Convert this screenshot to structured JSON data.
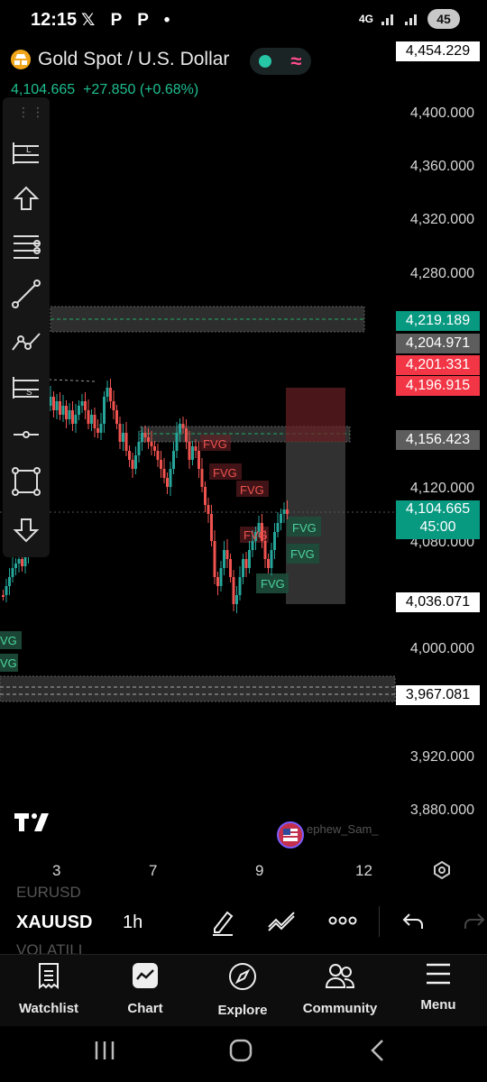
{
  "status_bar": {
    "time": "12:15",
    "apps": "𝕏 P P •",
    "network": "4G",
    "battery": "45"
  },
  "header": {
    "title": "Gold Spot / U.S. Dollar",
    "last_price": "4,104.665",
    "change": "+27.850",
    "change_pct": "(+0.68%)"
  },
  "price_axis": {
    "labels": [
      "4,400.000",
      "4,360.000",
      "4,320.000",
      "4,280.000",
      "4,120.000",
      "4,080.000",
      "4,000.000",
      "3,920.000",
      "3,880.000"
    ],
    "tags": {
      "top": "4,454.229",
      "level_1": "4,219.189",
      "level_2": "4,204.971",
      "level_3": "4,201.331",
      "level_4": "4,196.915",
      "level_5": "4,156.423",
      "current": "4,104.665",
      "countdown": "45:00",
      "level_6": "4,036.071",
      "level_7": "3,967.081"
    }
  },
  "time_axis": {
    "labels": [
      "3",
      "7",
      "9",
      "12"
    ]
  },
  "annotations": {
    "fvg": "FVG",
    "watermark": "ephew_Sam_"
  },
  "symbol_bar": {
    "ghost_top": "EURUSD",
    "symbol": "XAUUSD",
    "interval": "1h",
    "ghost_bottom": "VOLATILI"
  },
  "nav": {
    "items": [
      {
        "label": "Watchlist",
        "icon": "watchlist-icon"
      },
      {
        "label": "Chart",
        "icon": "chart-icon"
      },
      {
        "label": "Explore",
        "icon": "compass-icon"
      },
      {
        "label": "Community",
        "icon": "community-icon"
      },
      {
        "label": "Menu",
        "icon": "hamburger-icon"
      }
    ]
  },
  "colors": {
    "up": "#26a69a",
    "down": "#ef5350",
    "gold": "#f0a51a",
    "accent_green": "#089981",
    "accent_red": "#f23645"
  }
}
